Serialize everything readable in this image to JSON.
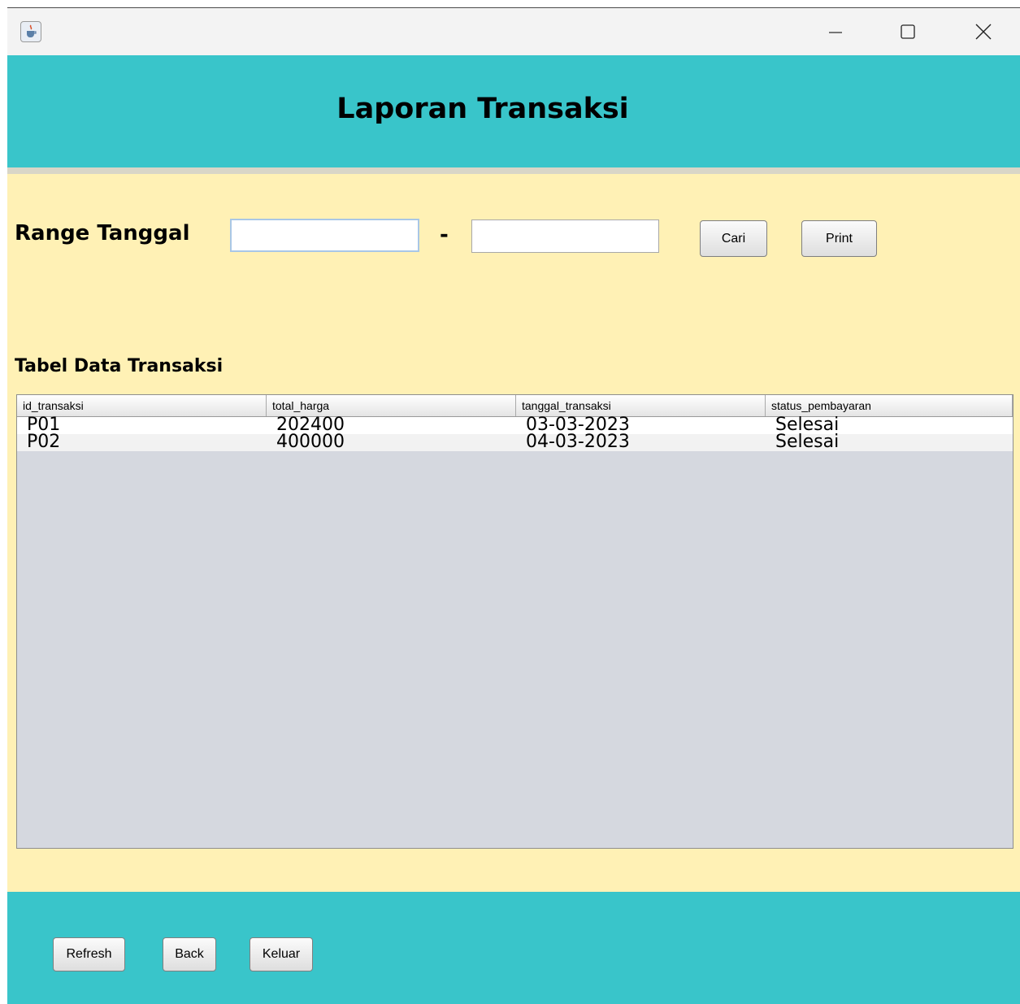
{
  "window": {
    "icons": {
      "app": "java-cup-icon",
      "minimize": "minimize-icon",
      "maximize": "maximize-icon",
      "close": "close-icon"
    }
  },
  "header": {
    "title": "Laporan Transaksi"
  },
  "filter": {
    "label": "Range Tanggal",
    "separator": "-",
    "start_value": "",
    "end_value": "",
    "search_label": "Cari",
    "print_label": "Print"
  },
  "table": {
    "title": "Tabel Data Transaksi",
    "columns": [
      "id_transaksi",
      "total_harga",
      "tanggal_transaksi",
      "status_pembayaran"
    ],
    "rows": [
      [
        "P01",
        "202400",
        "03-03-2023",
        "Selesai"
      ],
      [
        "P02",
        "400000",
        "04-03-2023",
        "Selesai"
      ]
    ]
  },
  "footer": {
    "refresh_label": "Refresh",
    "back_label": "Back",
    "exit_label": "Keluar"
  },
  "colors": {
    "header": "#39c5ca",
    "body": "#fff1b5",
    "table_bg": "#d5d8df"
  }
}
